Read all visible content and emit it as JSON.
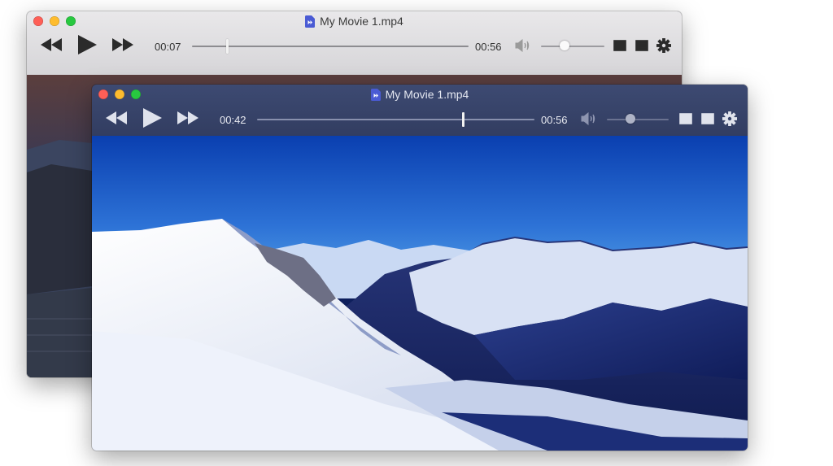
{
  "windows": [
    {
      "id": "back",
      "title": "My Movie 1.mp4",
      "theme": "light",
      "elapsed": "00:07",
      "duration": "00:56",
      "progress": 0.125,
      "volume": 0.55
    },
    {
      "id": "front",
      "title": "My Movie 1.mp4",
      "theme": "dark",
      "elapsed": "00:42",
      "duration": "00:56",
      "progress": 0.75,
      "volume": 0.4
    }
  ],
  "colors": {
    "close": "#fe5f57",
    "minimize": "#febc2e",
    "zoom": "#28c840",
    "doc_icon": "#4a5bd4",
    "sky_top": "#0a3fb0",
    "sky_bottom": "#5aa8e8"
  },
  "icons": [
    "rewind-icon",
    "play-icon",
    "fast-forward-icon",
    "volume-icon",
    "pip-icon",
    "playlist-icon",
    "gear-icon",
    "document-icon"
  ]
}
